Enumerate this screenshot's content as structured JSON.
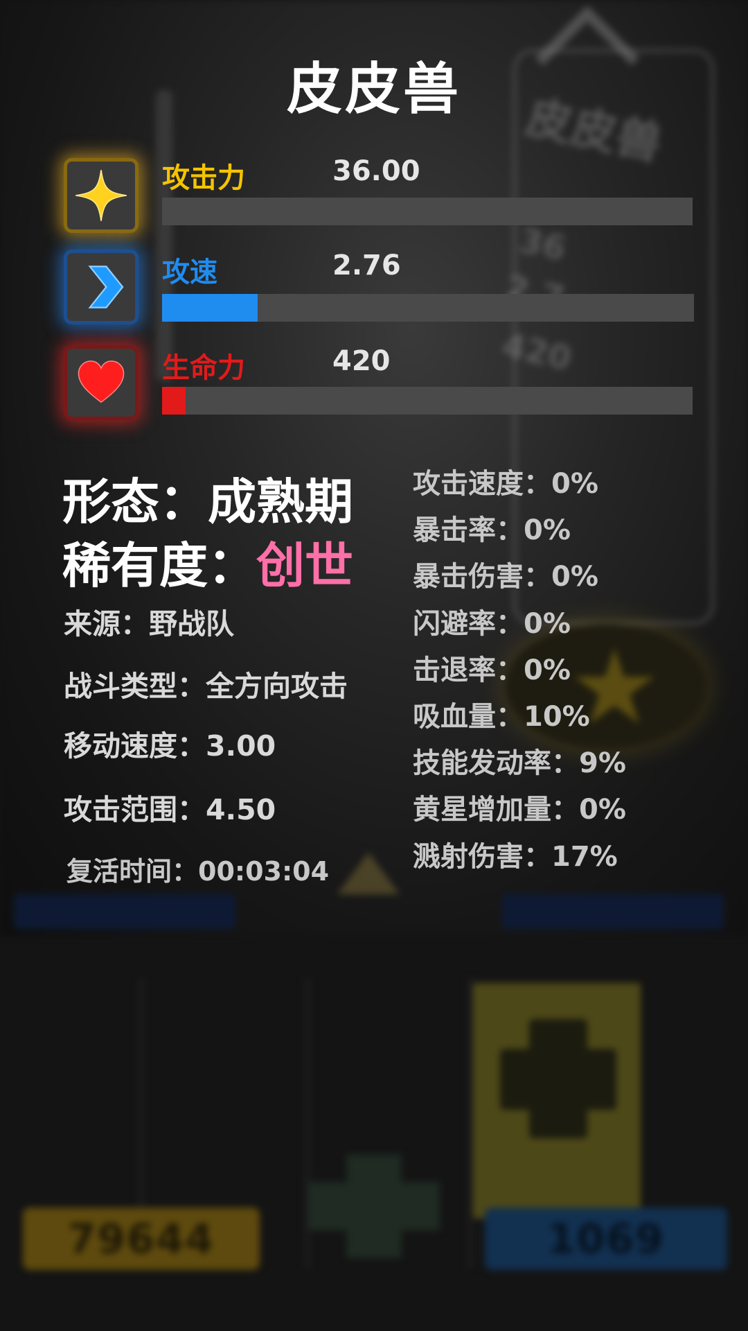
{
  "title": "皮皮兽",
  "stats": [
    {
      "label": "攻击力",
      "value": "36.00",
      "fill": 0.0,
      "color": "#f5c400",
      "icon": "sparkle-star-icon"
    },
    {
      "label": "攻速",
      "value": "2.76",
      "fill": 0.18,
      "color": "#1f8cf0",
      "icon": "chevron-right-icon"
    },
    {
      "label": "生命力",
      "value": "420",
      "fill": 0.045,
      "color": "#e21a1a",
      "icon": "heart-icon"
    }
  ],
  "form": {
    "label": "形态：",
    "value": "成熟期"
  },
  "rarity": {
    "label": "稀有度：",
    "value": "创世",
    "color": "#ff6fa8"
  },
  "source": "来源：野战队",
  "battle_type": "战斗类型：全方向攻击",
  "move_speed": "移动速度：3.00",
  "attack_range": "攻击范围：4.50",
  "revive_time": "复活时间：00:03:04",
  "attributes": [
    "攻击速度：0%",
    "暴击率：0%",
    "暴击伤害：0%",
    "闪避率：0%",
    "击退率：0%",
    "吸血量：10%",
    "技能发动率：9%",
    "黄星增加量：0%",
    "溅射伤害：17%"
  ],
  "background": {
    "card_name": "皮皮兽",
    "card_stats": [
      "36",
      "2.7",
      "420"
    ],
    "currency_gold": "79644",
    "currency_blue": "1069"
  }
}
